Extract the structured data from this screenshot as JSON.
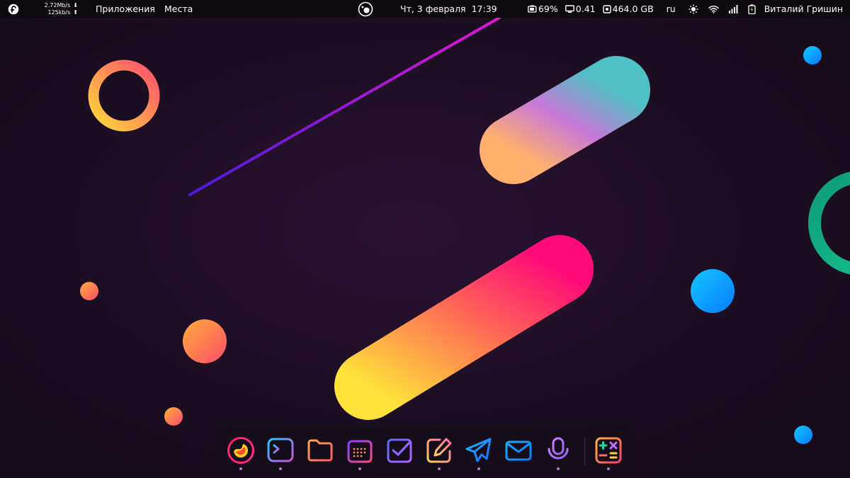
{
  "topbar": {
    "distro_icon": "fedora-logo-icon",
    "netspeed": {
      "down": "2.72Mb/s",
      "up": "125kb/s"
    },
    "apps_label": "Приложения",
    "places_label": "Места",
    "overview_icon": "activities-icon",
    "clock": {
      "date": "Чт, 3 февраля",
      "time": "17:39"
    },
    "tray": {
      "battery": "69%",
      "load": "0.41",
      "disk": "464.0 GB",
      "keyboard_layout": "ru",
      "user_name": "Виталий Гришин"
    }
  },
  "dock": {
    "apps": [
      {
        "name": "firefox",
        "icon": "firefox-icon",
        "running": true
      },
      {
        "name": "terminal",
        "icon": "terminal-icon",
        "running": true
      },
      {
        "name": "files",
        "icon": "folder-icon",
        "running": false
      },
      {
        "name": "calendar",
        "icon": "calendar-icon",
        "running": true
      },
      {
        "name": "tasks",
        "icon": "checkbox-icon",
        "running": false
      },
      {
        "name": "text-editor",
        "icon": "edit-icon",
        "running": true
      },
      {
        "name": "telegram",
        "icon": "telegram-icon",
        "running": true
      },
      {
        "name": "mail",
        "icon": "mail-icon",
        "running": false
      },
      {
        "name": "voice-recorder",
        "icon": "microphone-icon",
        "running": true
      },
      {
        "name": "calculator",
        "icon": "calculator-icon",
        "running": true
      }
    ]
  },
  "colors": {
    "background": "#1c0e22",
    "topbar": "#0d090f",
    "dock": "#150d19",
    "accent": "#c06bd3"
  }
}
